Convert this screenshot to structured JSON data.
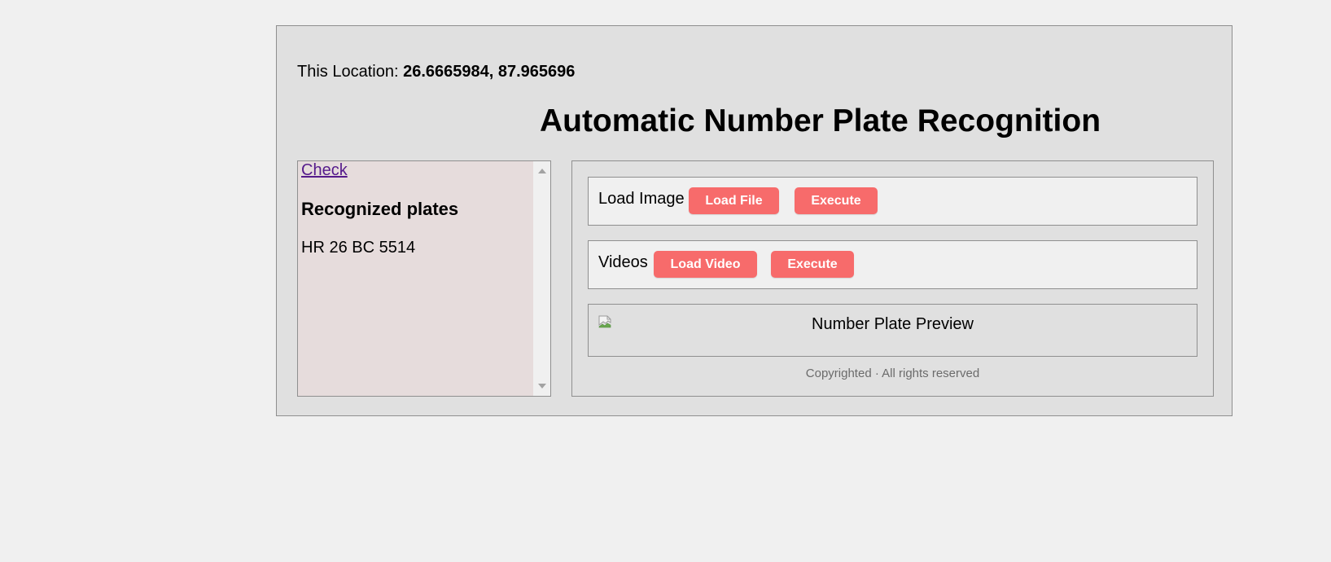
{
  "location": {
    "label": "This Location:",
    "coords": "26.6665984, 87.965696"
  },
  "title": "Automatic Number Plate Recognition",
  "sidebar": {
    "check_link": "Check",
    "heading": "Recognized plates",
    "plates": [
      "HR 26 BC 5514"
    ]
  },
  "image_row": {
    "label": "Load Image",
    "load_button": "Load File",
    "execute_button": "Execute"
  },
  "video_row": {
    "label": "Videos",
    "load_button": "Load Video",
    "execute_button": "Execute"
  },
  "preview": {
    "alt_text": "Number Plate Preview",
    "icon": "broken-image-icon"
  },
  "footer": "Copyrighted · All rights reserved",
  "colors": {
    "button": "#f76b6b",
    "sidebar_bg": "#e6dcdc",
    "link": "#551a8b"
  }
}
